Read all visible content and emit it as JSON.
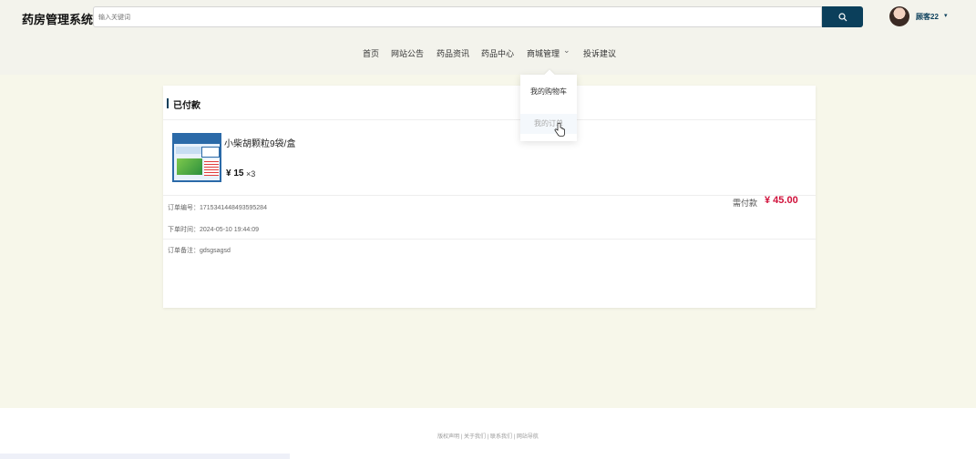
{
  "header": {
    "brand": "药房管理系统",
    "search_placeholder": "输入关键词",
    "user_name": "顾客22",
    "user_caret": "▾"
  },
  "nav": {
    "items": [
      "首页",
      "网站公告",
      "药品资讯",
      "药品中心",
      "商城管理",
      "投诉建议"
    ],
    "dropdown_caret": "⌄"
  },
  "dropdown": {
    "items": [
      "我的购物车",
      "我的订单"
    ]
  },
  "order": {
    "status_title": "已付款",
    "product_name": "小柴胡颗粒9袋/盒",
    "price": "¥ 15",
    "quantity": "×3",
    "order_no_label": "订单编号：",
    "order_no": "171534144849359528​4",
    "order_time_label": "下单时间：",
    "order_time": "2024-05-10 19:44:09",
    "remark_label": "订单备注：",
    "remark": "gdsgsagsd",
    "paid_label": "需付款",
    "paid_amount": "¥ 45.00"
  },
  "footer": {
    "links": "版权声明 | 关于我们 | 联系我们 | 网站导航"
  },
  "colors": {
    "primary": "#0b3f5b",
    "price_red": "#d0103a",
    "header_bg": "#f3f3ec",
    "main_bg": "#f7f7ea"
  },
  "icons": [
    "search-icon",
    "chevron-down-icon",
    "hand-cursor-icon"
  ]
}
